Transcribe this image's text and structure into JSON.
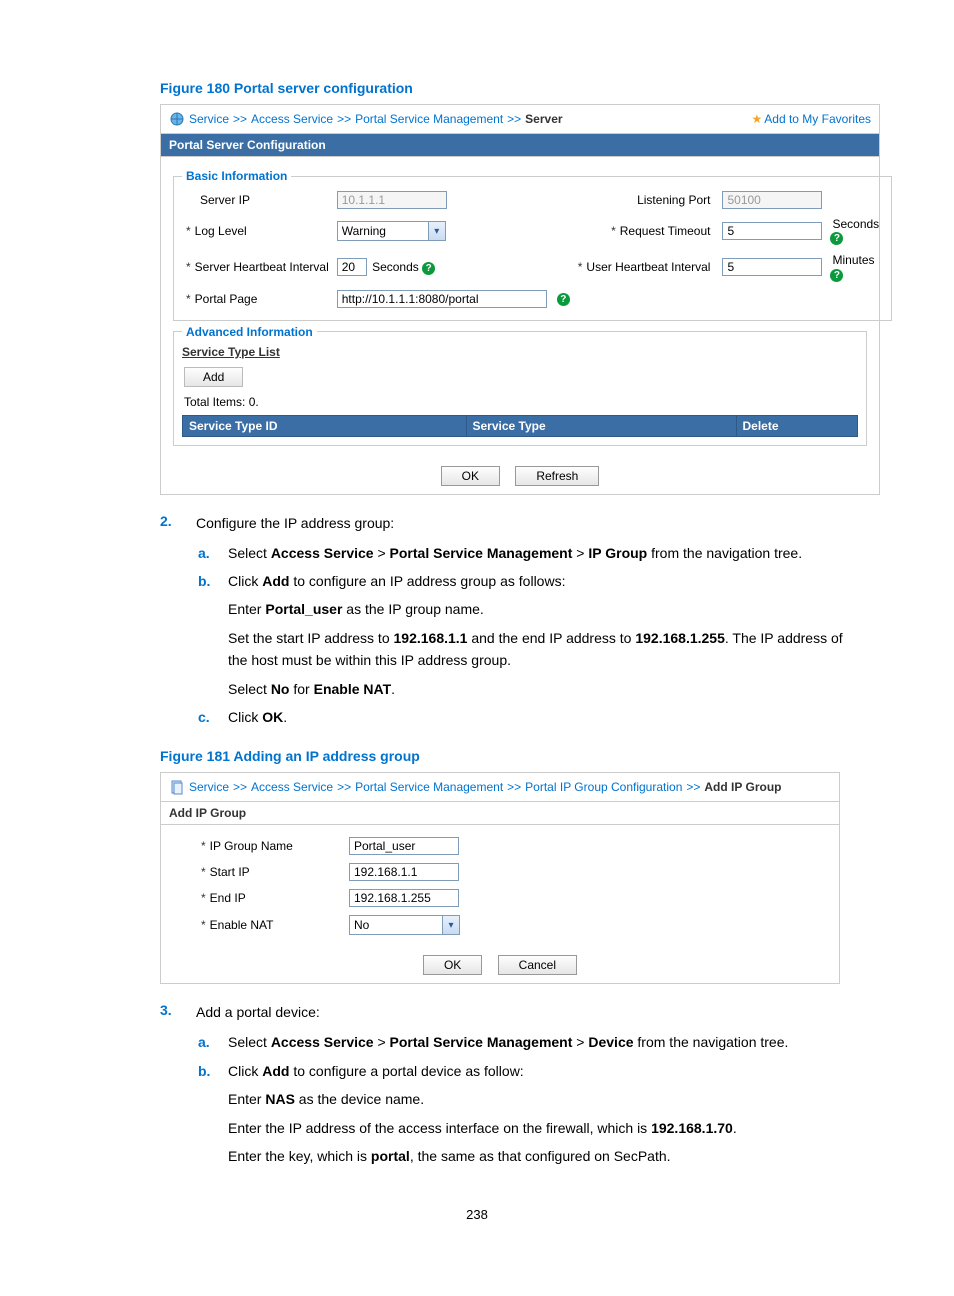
{
  "figure180": {
    "title": "Figure 180 Portal server configuration",
    "breadcrumb": {
      "service": "Service",
      "access": "Access Service",
      "psm": "Portal Service Management",
      "current": "Server",
      "fav": "Add to My Favorites"
    },
    "panelHeader": "Portal Server Configuration",
    "basic": {
      "legend": "Basic Information",
      "serverIPLabel": "Server IP",
      "serverIPValue": "10.1.1.1",
      "listenPortLabel": "Listening Port",
      "listenPortValue": "50100",
      "logLevelLabel": "Log Level",
      "logLevelValue": "Warning",
      "requestTimeoutLabel": "Request Timeout",
      "requestTimeoutValue": "5",
      "secondsUnit": "Seconds",
      "shbiLabel": "Server Heartbeat Interval",
      "shbiValue": "20",
      "uhbiLabel": "User Heartbeat Interval",
      "uhbiValue": "5",
      "minutesUnit": "Minutes",
      "portalPageLabel": "Portal Page",
      "portalPageValue": "http://10.1.1.1:8080/portal"
    },
    "adv": {
      "legend": "Advanced Information",
      "listTitle": "Service Type List",
      "addBtn": "Add",
      "totalItems": "Total Items: 0.",
      "colId": "Service Type ID",
      "colType": "Service Type",
      "colDelete": "Delete"
    },
    "okBtn": "OK",
    "refreshBtn": "Refresh"
  },
  "step2": {
    "num": "2.",
    "text": "Configure the IP address group:",
    "a_letter": "a.",
    "a_text_pre": "Select ",
    "a_as": "Access Service",
    "a_gt": " > ",
    "a_psm": "Portal Service Management",
    "a_ipg": "IP Group",
    "a_tail": " from the navigation tree.",
    "b_letter": "b.",
    "b_text_pre": "Click ",
    "b_add": "Add",
    "b_text_post": " to configure an IP address group as follows:",
    "b_block1_pre": "Enter ",
    "b_block1_bold": "Portal_user",
    "b_block1_post": " as the IP group name.",
    "b_block2_pre": "Set the start IP address to ",
    "b_block2_ip1": "192.168.1.1",
    "b_block2_mid": " and the end IP address to ",
    "b_block2_ip2": "192.168.1.255",
    "b_block2_post": ". The IP address of the host must be within this IP address group.",
    "b_block3_pre": "Select ",
    "b_block3_no": "No",
    "b_block3_for": " for ",
    "b_block3_enat": "Enable NAT",
    "b_block3_post": ".",
    "c_letter": "c.",
    "c_text_pre": "Click ",
    "c_ok": "OK",
    "c_text_post": "."
  },
  "figure181": {
    "title": "Figure 181 Adding an IP address group",
    "breadcrumb": {
      "service": "Service",
      "access": "Access Service",
      "psm": "Portal Service Management",
      "pipg": "Portal IP Group Configuration",
      "current": "Add IP Group"
    },
    "panelHeader": "Add IP Group",
    "fields": {
      "ipGroupNameLabel": "IP Group Name",
      "ipGroupNameValue": "Portal_user",
      "startIPLabel": "Start IP",
      "startIPValue": "192.168.1.1",
      "endIPLabel": "End IP",
      "endIPValue": "192.168.1.255",
      "enableNATLabel": "Enable NAT",
      "enableNATValue": "No"
    },
    "okBtn": "OK",
    "cancelBtn": "Cancel"
  },
  "step3": {
    "num": "3.",
    "text": "Add a portal device:",
    "a_letter": "a.",
    "a_text_pre": "Select ",
    "a_as": "Access Service",
    "a_gt": " > ",
    "a_psm": "Portal Service Management",
    "a_dev": "Device",
    "a_tail": " from the navigation tree.",
    "b_letter": "b.",
    "b_text_pre": "Click ",
    "b_add": "Add",
    "b_text_post": " to configure a portal device as follow:",
    "b_block1_pre": "Enter ",
    "b_block1_bold": "NAS",
    "b_block1_post": " as the device name.",
    "b_block2_pre": "Enter the IP address of the access interface on the firewall, which is ",
    "b_block2_ip": "192.168.1.70",
    "b_block2_post": ".",
    "b_block3_pre": "Enter the key, which is ",
    "b_block3_bold": "portal",
    "b_block3_post": ", the same as that configured on SecPath."
  },
  "pageNumber": "238"
}
